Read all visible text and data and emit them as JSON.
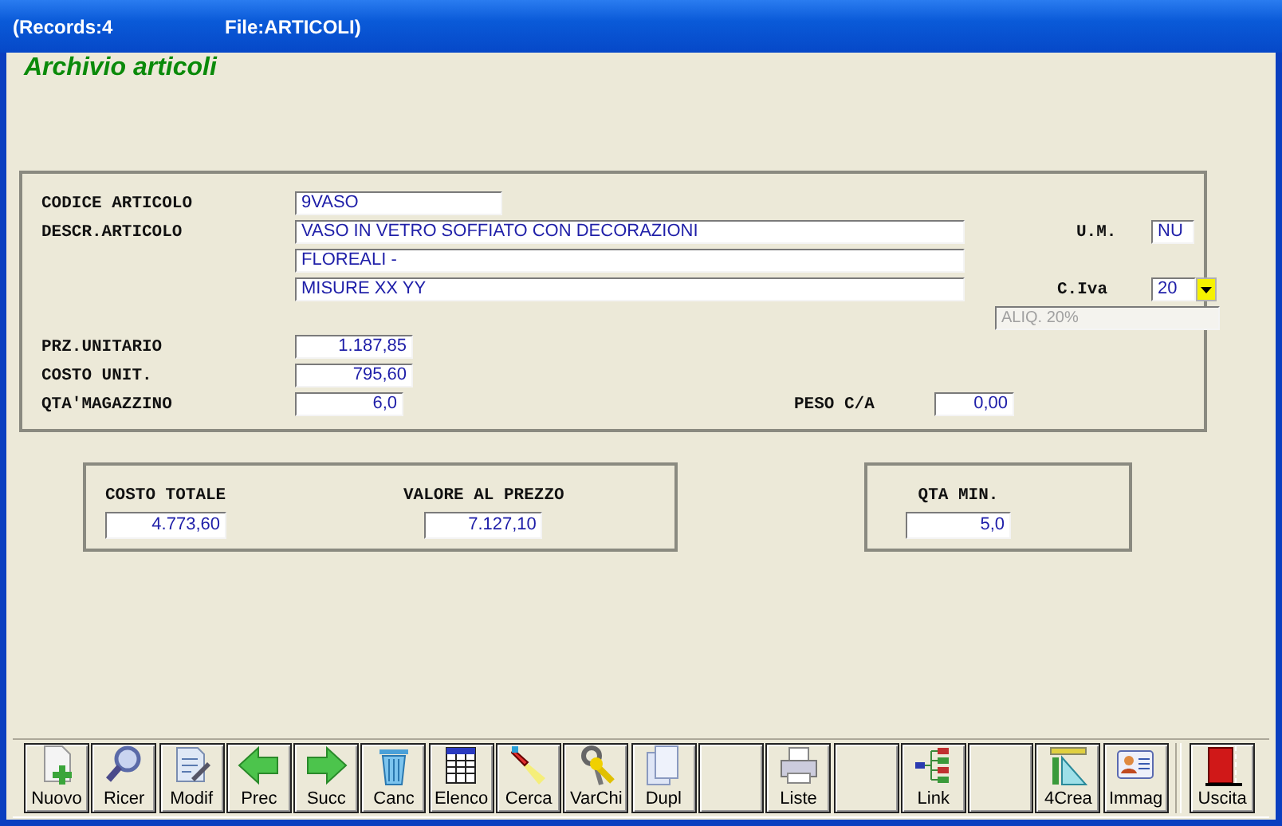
{
  "window": {
    "records": "(Records:4",
    "file": "File:ARTICOLI)"
  },
  "form_title": "Archivio articoli",
  "article": {
    "codice": {
      "label": "CODICE ARTICOLO",
      "value": "9VASO"
    },
    "descrizione": {
      "label": "DESCR.ARTICOLO",
      "lines": [
        "VASO IN VETRO SOFFIATO CON DECORAZIONI",
        "FLOREALI  -",
        "MISURE XX YY"
      ]
    },
    "um": {
      "label": "U.M.",
      "value": "NU"
    },
    "iva": {
      "label": "C.Iva",
      "value": "20",
      "description": "ALIQ. 20%"
    },
    "prezzo_unitario": {
      "label": "PRZ.UNITARIO",
      "value": "1.187,85"
    },
    "costo_unit": {
      "label": "COSTO UNIT.",
      "value": "795,60"
    },
    "qta_magazzino": {
      "label": "QTA'MAGAZZINO",
      "value": "6,0"
    },
    "peso": {
      "label": "PESO C/A",
      "value": "0,00"
    }
  },
  "totals": {
    "costo_totale": {
      "label": "COSTO TOTALE",
      "value": "4.773,60"
    },
    "valore_al_prezzo": {
      "label": "VALORE AL PREZZO",
      "value": "7.127,10"
    }
  },
  "qta_min": {
    "label": "QTA MIN.",
    "value": "5,0"
  },
  "toolbar": [
    {
      "kind": "new",
      "label": "Nuovo"
    },
    {
      "kind": "search",
      "label": "Ricer"
    },
    {
      "kind": "edit",
      "label": "Modif"
    },
    {
      "kind": "prev",
      "label": "Prec"
    },
    {
      "kind": "next",
      "label": "Succ"
    },
    {
      "kind": "delete",
      "label": "Canc"
    },
    {
      "kind": "list",
      "label": "Elenco"
    },
    {
      "kind": "find",
      "label": "Cerca"
    },
    {
      "kind": "keys",
      "label": "VarChi"
    },
    {
      "kind": "copy",
      "label": "Dupl"
    },
    {
      "kind": "blank"
    },
    {
      "kind": "print",
      "label": "Liste"
    },
    {
      "kind": "blank"
    },
    {
      "kind": "link",
      "label": "Link"
    },
    {
      "kind": "blank"
    },
    {
      "kind": "create",
      "label": "4Crea"
    },
    {
      "kind": "image",
      "label": "Immag"
    },
    {
      "kind": "exit",
      "label": "Uscita"
    }
  ]
}
